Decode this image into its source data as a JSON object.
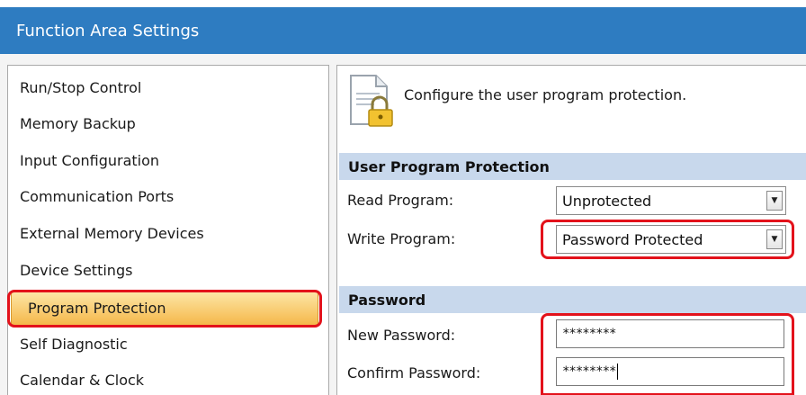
{
  "window": {
    "title": "Function Area Settings"
  },
  "sidebar": {
    "items": [
      {
        "label": "Run/Stop Control"
      },
      {
        "label": "Memory Backup"
      },
      {
        "label": "Input Configuration"
      },
      {
        "label": "Communication Ports"
      },
      {
        "label": "External Memory Devices"
      },
      {
        "label": "Device Settings"
      },
      {
        "label": "Program Protection"
      },
      {
        "label": "Self Diagnostic"
      },
      {
        "label": "Calendar & Clock"
      }
    ],
    "selected": "Program Protection"
  },
  "panel": {
    "description": "Configure the user program protection.",
    "icon": "document-lock-icon",
    "user_program_protection": {
      "header": "User Program Protection",
      "read_label": "Read Program:",
      "read_value": "Unprotected",
      "write_label": "Write Program:",
      "write_value": "Password Protected"
    },
    "password": {
      "header": "Password",
      "new_label": "New Password:",
      "new_value": "********",
      "confirm_label": "Confirm Password:",
      "confirm_value": "********"
    }
  },
  "colors": {
    "title_bar": "#2e7cc1",
    "section_header": "#c8d8ec",
    "selection": "#f5b84a",
    "highlight": "#e3121b"
  }
}
